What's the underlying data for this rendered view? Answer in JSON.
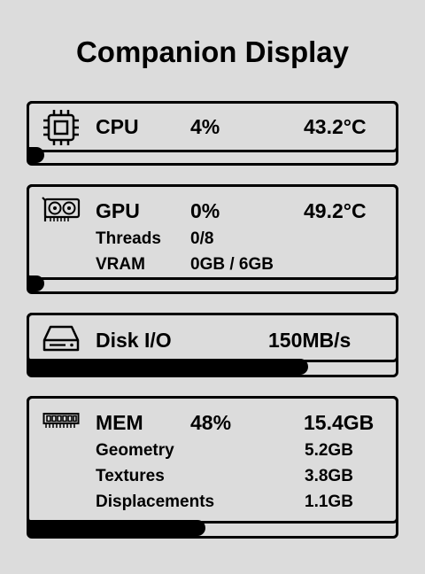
{
  "app": {
    "title": "Companion Display"
  },
  "cpu": {
    "label": "CPU",
    "usage": "4%",
    "temp": "43.2°C",
    "usage_fraction": 0.04,
    "icon": "cpu-icon"
  },
  "gpu": {
    "label": "GPU",
    "usage": "0%",
    "temp": "49.2°C",
    "usage_fraction": 0.0,
    "icon": "gpu-icon",
    "threads_label": "Threads",
    "threads_value": "0/8",
    "vram_label": "VRAM",
    "vram_value": "0GB / 6GB"
  },
  "disk": {
    "label": "Disk I/O",
    "rate": "150MB/s",
    "activity_fraction": 0.76,
    "icon": "disk-icon"
  },
  "mem": {
    "label": "MEM",
    "usage": "48%",
    "total": "15.4GB",
    "usage_fraction": 0.48,
    "icon": "memory-icon",
    "rows": [
      {
        "label": "Geometry",
        "value": "5.2GB"
      },
      {
        "label": "Textures",
        "value": "3.8GB"
      },
      {
        "label": "Displacements",
        "value": "1.1GB"
      }
    ]
  }
}
